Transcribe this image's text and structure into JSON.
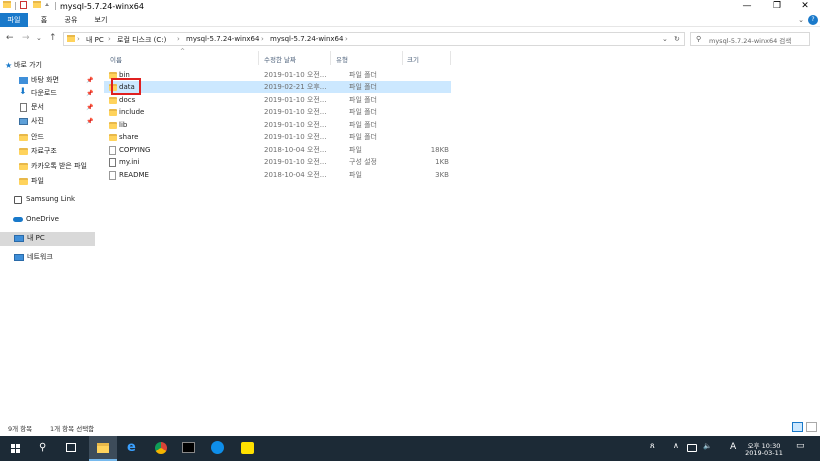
{
  "window": {
    "title": "mysql-5.7.24-winx64",
    "controls": {
      "minimize": "—",
      "maximize": "❐",
      "close": "✕"
    }
  },
  "ribbon": {
    "tabs": [
      "파일",
      "홈",
      "공유",
      "보기"
    ],
    "accent": "#1979ca",
    "chevron": "⌄",
    "help": "?"
  },
  "nav": {
    "back": "←",
    "forward": "→",
    "recent": "⌄",
    "up": "↑",
    "breadcrumb": [
      "내 PC",
      "로컬 디스크 (C:)",
      "mysql-5.7.24-winx64",
      "mysql-5.7.24-winx64"
    ],
    "separator": "›",
    "dropdown": "⌄",
    "refresh": "↻",
    "search_placeholder": "mysql-5.7.24-winx64 검색"
  },
  "sidebar": {
    "quick_access": "바로 가기",
    "quick_items": [
      {
        "label": "바탕 화면",
        "icon": "desktop-icon",
        "pinned": true
      },
      {
        "label": "다운로드",
        "icon": "download-icon",
        "pinned": true
      },
      {
        "label": "문서",
        "icon": "document-icon",
        "pinned": true
      },
      {
        "label": "사진",
        "icon": "picture-icon",
        "pinned": true
      },
      {
        "label": "안드",
        "icon": "folder-icon",
        "pinned": false
      },
      {
        "label": "자료구조",
        "icon": "folder-icon",
        "pinned": false
      },
      {
        "label": "카카오톡 받은 파일",
        "icon": "folder-icon",
        "pinned": false
      },
      {
        "label": "파일",
        "icon": "folder-icon",
        "pinned": false
      }
    ],
    "samsung_link": "Samsung Link",
    "onedrive": "OneDrive",
    "this_pc": "내 PC",
    "network": "네트워크",
    "pin_glyph": "📌"
  },
  "columns": {
    "name": "이름",
    "date": "수정한 날짜",
    "type": "유형",
    "size": "크기"
  },
  "files": [
    {
      "name": "bin",
      "date": "2019-01-10 오전...",
      "type": "파일 폴더",
      "size": "",
      "kind": "folder"
    },
    {
      "name": "data",
      "date": "2019-02-21 오후...",
      "type": "파일 폴더",
      "size": "",
      "kind": "folder",
      "selected": true
    },
    {
      "name": "docs",
      "date": "2019-01-10 오전...",
      "type": "파일 폴더",
      "size": "",
      "kind": "folder"
    },
    {
      "name": "include",
      "date": "2019-01-10 오전...",
      "type": "파일 폴더",
      "size": "",
      "kind": "folder"
    },
    {
      "name": "lib",
      "date": "2019-01-10 오전...",
      "type": "파일 폴더",
      "size": "",
      "kind": "folder"
    },
    {
      "name": "share",
      "date": "2019-01-10 오전...",
      "type": "파일 폴더",
      "size": "",
      "kind": "folder"
    },
    {
      "name": "COPYING",
      "date": "2018-10-04 오전...",
      "type": "파일",
      "size": "18KB",
      "kind": "file"
    },
    {
      "name": "my.ini",
      "date": "2019-01-10 오전...",
      "type": "구성 설정",
      "size": "1KB",
      "kind": "file"
    },
    {
      "name": "README",
      "date": "2018-10-04 오전...",
      "type": "파일",
      "size": "3KB",
      "kind": "file"
    }
  ],
  "status": {
    "count": "9개 항목",
    "selected": "1개 항목 선택함"
  },
  "taskbar": {
    "time": "오후 10:30",
    "date": "2019-03-11",
    "ime": "A",
    "tray_icons": [
      "people-icon",
      "chevron-up-icon",
      "network-icon",
      "volume-icon"
    ],
    "tray_glyphs": {
      "people": "ጸ",
      "chevron": "∧",
      "volume": "🔈"
    },
    "notification": "▭"
  }
}
